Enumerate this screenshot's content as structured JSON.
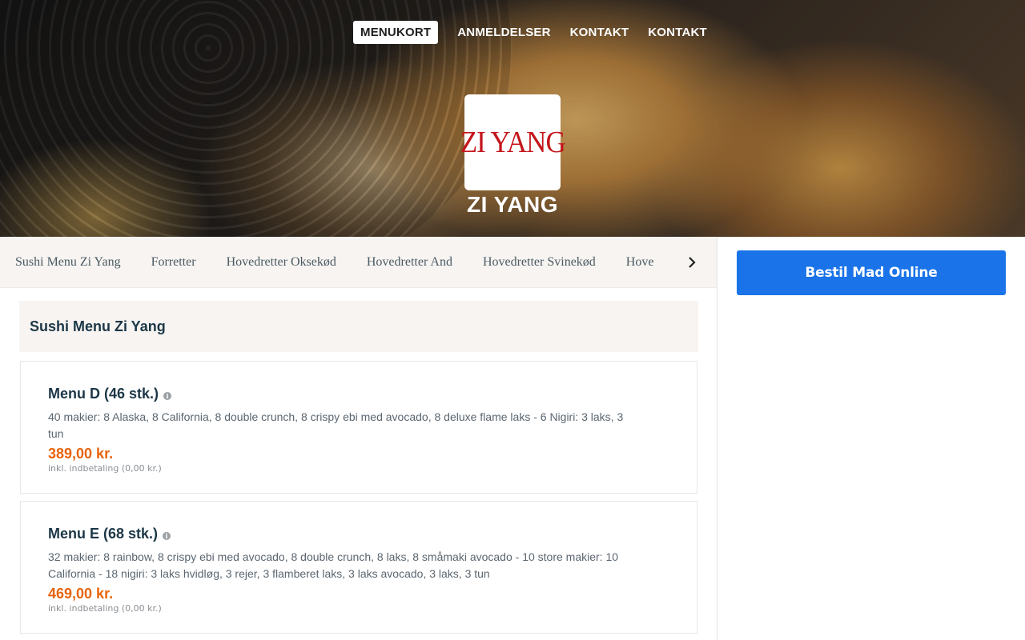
{
  "nav": {
    "items": [
      {
        "label": "MENUKORT",
        "active": true
      },
      {
        "label": "ANMELDELSER",
        "active": false
      },
      {
        "label": "KONTAKT",
        "active": false
      },
      {
        "label": "KONTAKT",
        "active": false
      }
    ]
  },
  "brand": {
    "logo_text": "ZI YANG",
    "name": "ZI YANG",
    "logo_color": "#c4161c"
  },
  "categories": [
    "Sushi Menu Zi Yang",
    "Forretter",
    "Hovedretter Oksekød",
    "Hovedretter And",
    "Hovedretter Svinekød",
    "Hove"
  ],
  "sidebar": {
    "order_button": "Bestil Mad Online",
    "accent": "#1a73e8"
  },
  "section": {
    "title": "Sushi Menu Zi Yang",
    "items": [
      {
        "name": "Menu D (46 stk.)",
        "description": "40 makier: 8 Alaska, 8 California, 8 double crunch, 8 crispy ebi med avocado, 8 deluxe flame laks - 6 Nigiri: 3 laks, 3 tun",
        "price": "389,00 kr.",
        "note": "inkl. indbetaling (0,00 kr.)"
      },
      {
        "name": "Menu E (68 stk.)",
        "description": "32 makier: 8 rainbow, 8 crispy ebi med avocado, 8 double crunch, 8 laks, 8 småmaki avocado - 10 store makier: 10 California - 18 nigiri: 3 laks hvidløg, 3 rejer, 3 flamberet laks, 3 laks avocado, 3 laks, 3 tun",
        "price": "469,00 kr.",
        "note": "inkl. indbetaling (0,00 kr.)"
      }
    ]
  },
  "colors": {
    "price": "#e8630a",
    "heading": "#1c3747"
  }
}
